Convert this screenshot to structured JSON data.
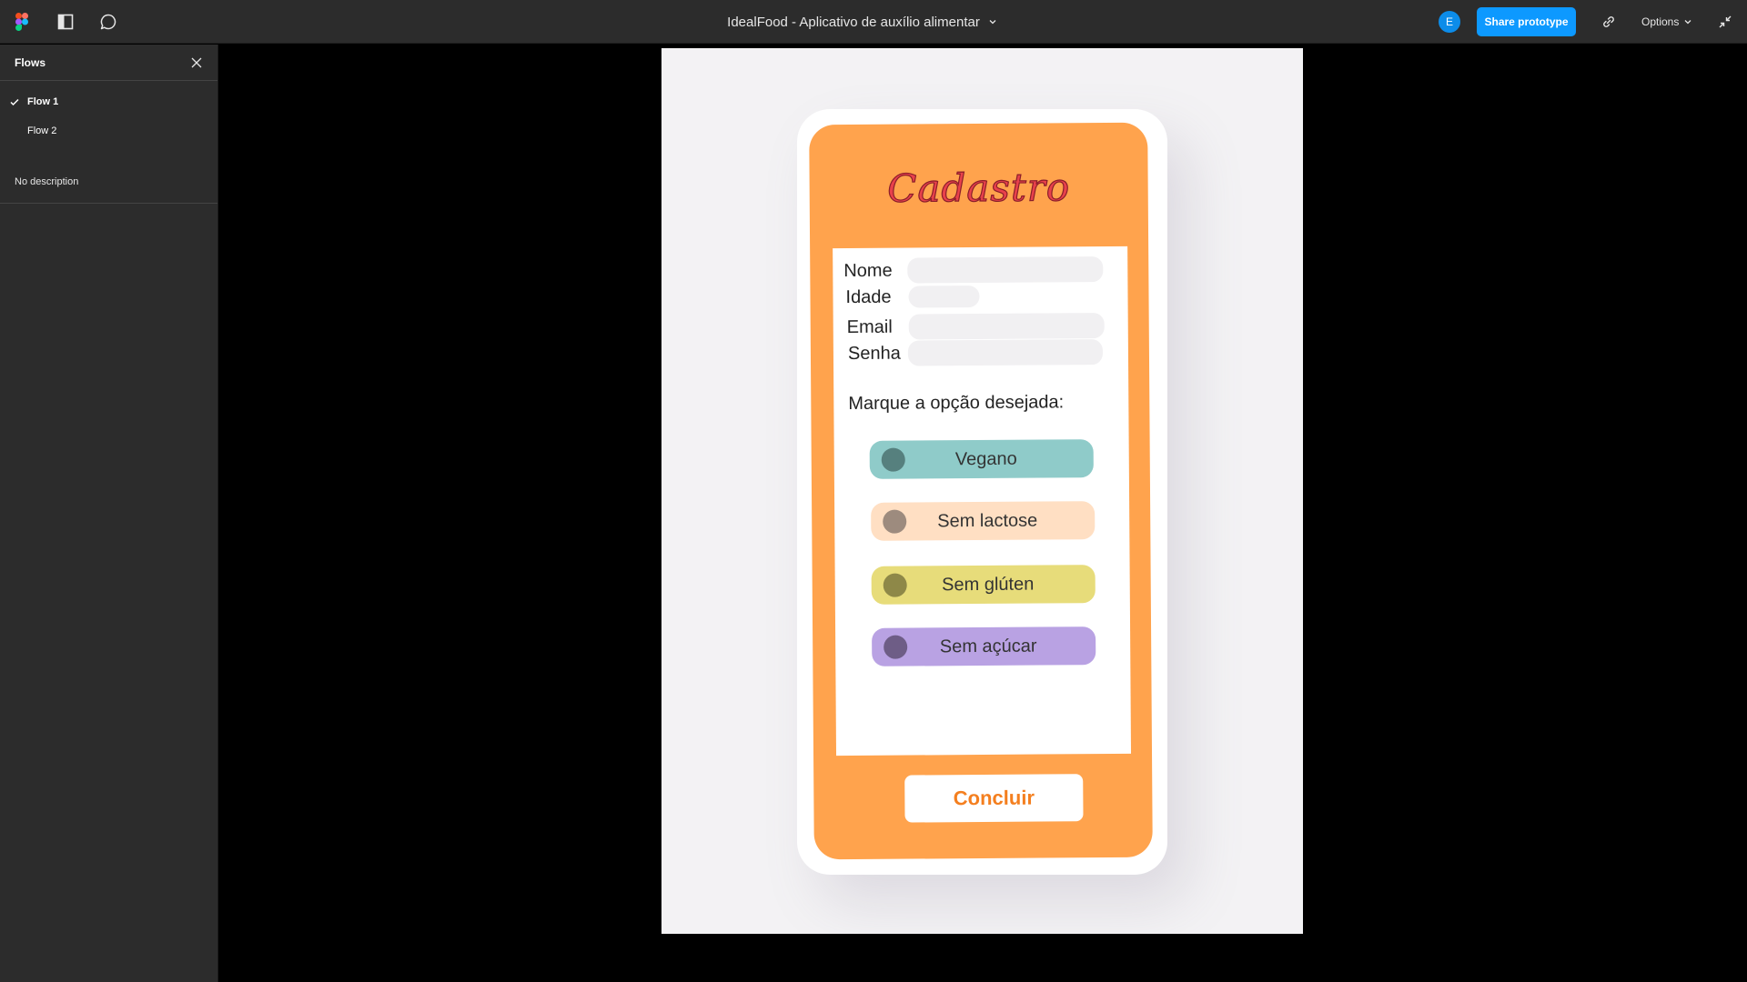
{
  "topbar": {
    "title": "IdealFood - Aplicativo de auxílio alimentar",
    "avatar_initial": "E",
    "share_label": "Share prototype",
    "options_label": "Options"
  },
  "sidebar": {
    "title": "Flows",
    "flows": [
      {
        "label": "Flow 1",
        "active": true
      },
      {
        "label": "Flow 2",
        "active": false
      }
    ],
    "description": "No description"
  },
  "screen": {
    "title": "Cadastro",
    "fields": [
      {
        "label": "Nome"
      },
      {
        "label": "Idade"
      },
      {
        "label": "Email"
      },
      {
        "label": "Senha"
      }
    ],
    "prompt": "Marque a opção desejada:",
    "options": [
      {
        "label": "Vegano",
        "color": "#8fcbc9",
        "dot": "#56807e"
      },
      {
        "label": "Sem lactose",
        "color": "#ffdfc3",
        "dot": "#9d8b7e"
      },
      {
        "label": "Sem glúten",
        "color": "#e7dc7a",
        "dot": "#8e8848"
      },
      {
        "label": "Sem açúcar",
        "color": "#b9a2e3",
        "dot": "#6e5d86"
      }
    ],
    "submit_label": "Concluir"
  },
  "colors": {
    "accent": "#0d99ff",
    "phone_orange": "#ffa34d",
    "title_red": "#e8414b"
  }
}
